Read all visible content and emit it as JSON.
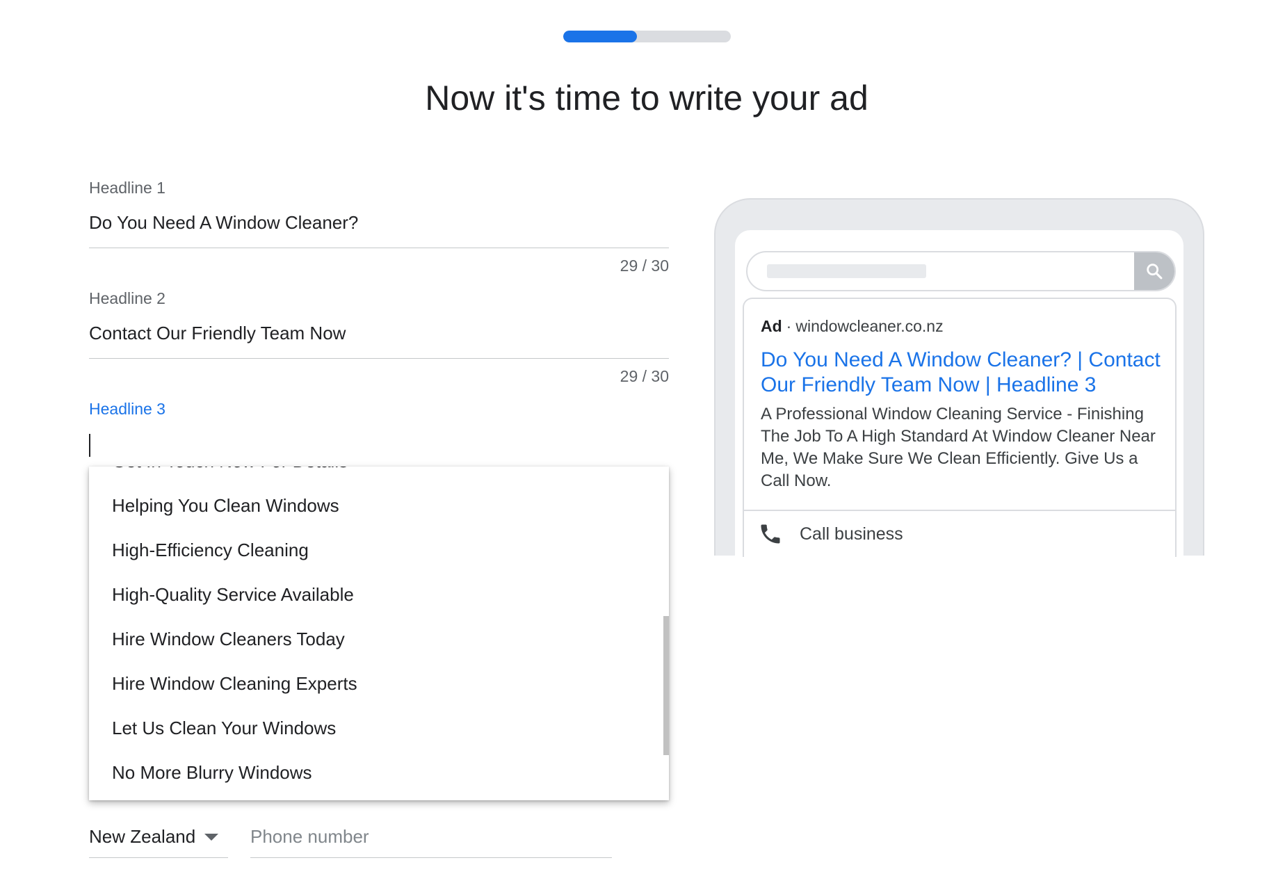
{
  "progress": {
    "fraction": 0.44
  },
  "title": "Now it's time to write your ad",
  "fields": [
    {
      "label": "Headline 1",
      "value": "Do You Need A Window Cleaner?",
      "counter": "29 / 30"
    },
    {
      "label": "Headline 2",
      "value": "Contact Our Friendly Team Now",
      "counter": "29 / 30"
    },
    {
      "label": "Headline 3",
      "value": ""
    }
  ],
  "suggestions": {
    "partial_item": "Get In Touch Now For Details",
    "items": [
      "Helping You Clean Windows",
      "High-Efficiency Cleaning",
      "High-Quality Service Available",
      "Hire Window Cleaners Today",
      "Hire Window Cleaning Experts",
      "Let Us Clean Your Windows",
      "No More Blurry Windows"
    ]
  },
  "phone_input": {
    "country": "New Zealand",
    "placeholder": "Phone number"
  },
  "preview": {
    "ad_badge": "Ad",
    "separator": "·",
    "domain": "windowcleaner.co.nz",
    "headline": "Do You Need A Window Cleaner? | Contact Our Friendly Team Now | Headline 3",
    "description": "A Professional Window Cleaning Service - Finishing The Job To A High Standard At Window Cleaner Near Me, We Make Sure We Clean Efficiently. Give Us a Call Now.",
    "call_label": "Call business",
    "icons": {
      "search": "search-icon",
      "call": "phone-icon"
    }
  },
  "colors": {
    "accent": "#1a73e8",
    "link": "#1a73e8",
    "track": "#dadce0"
  }
}
